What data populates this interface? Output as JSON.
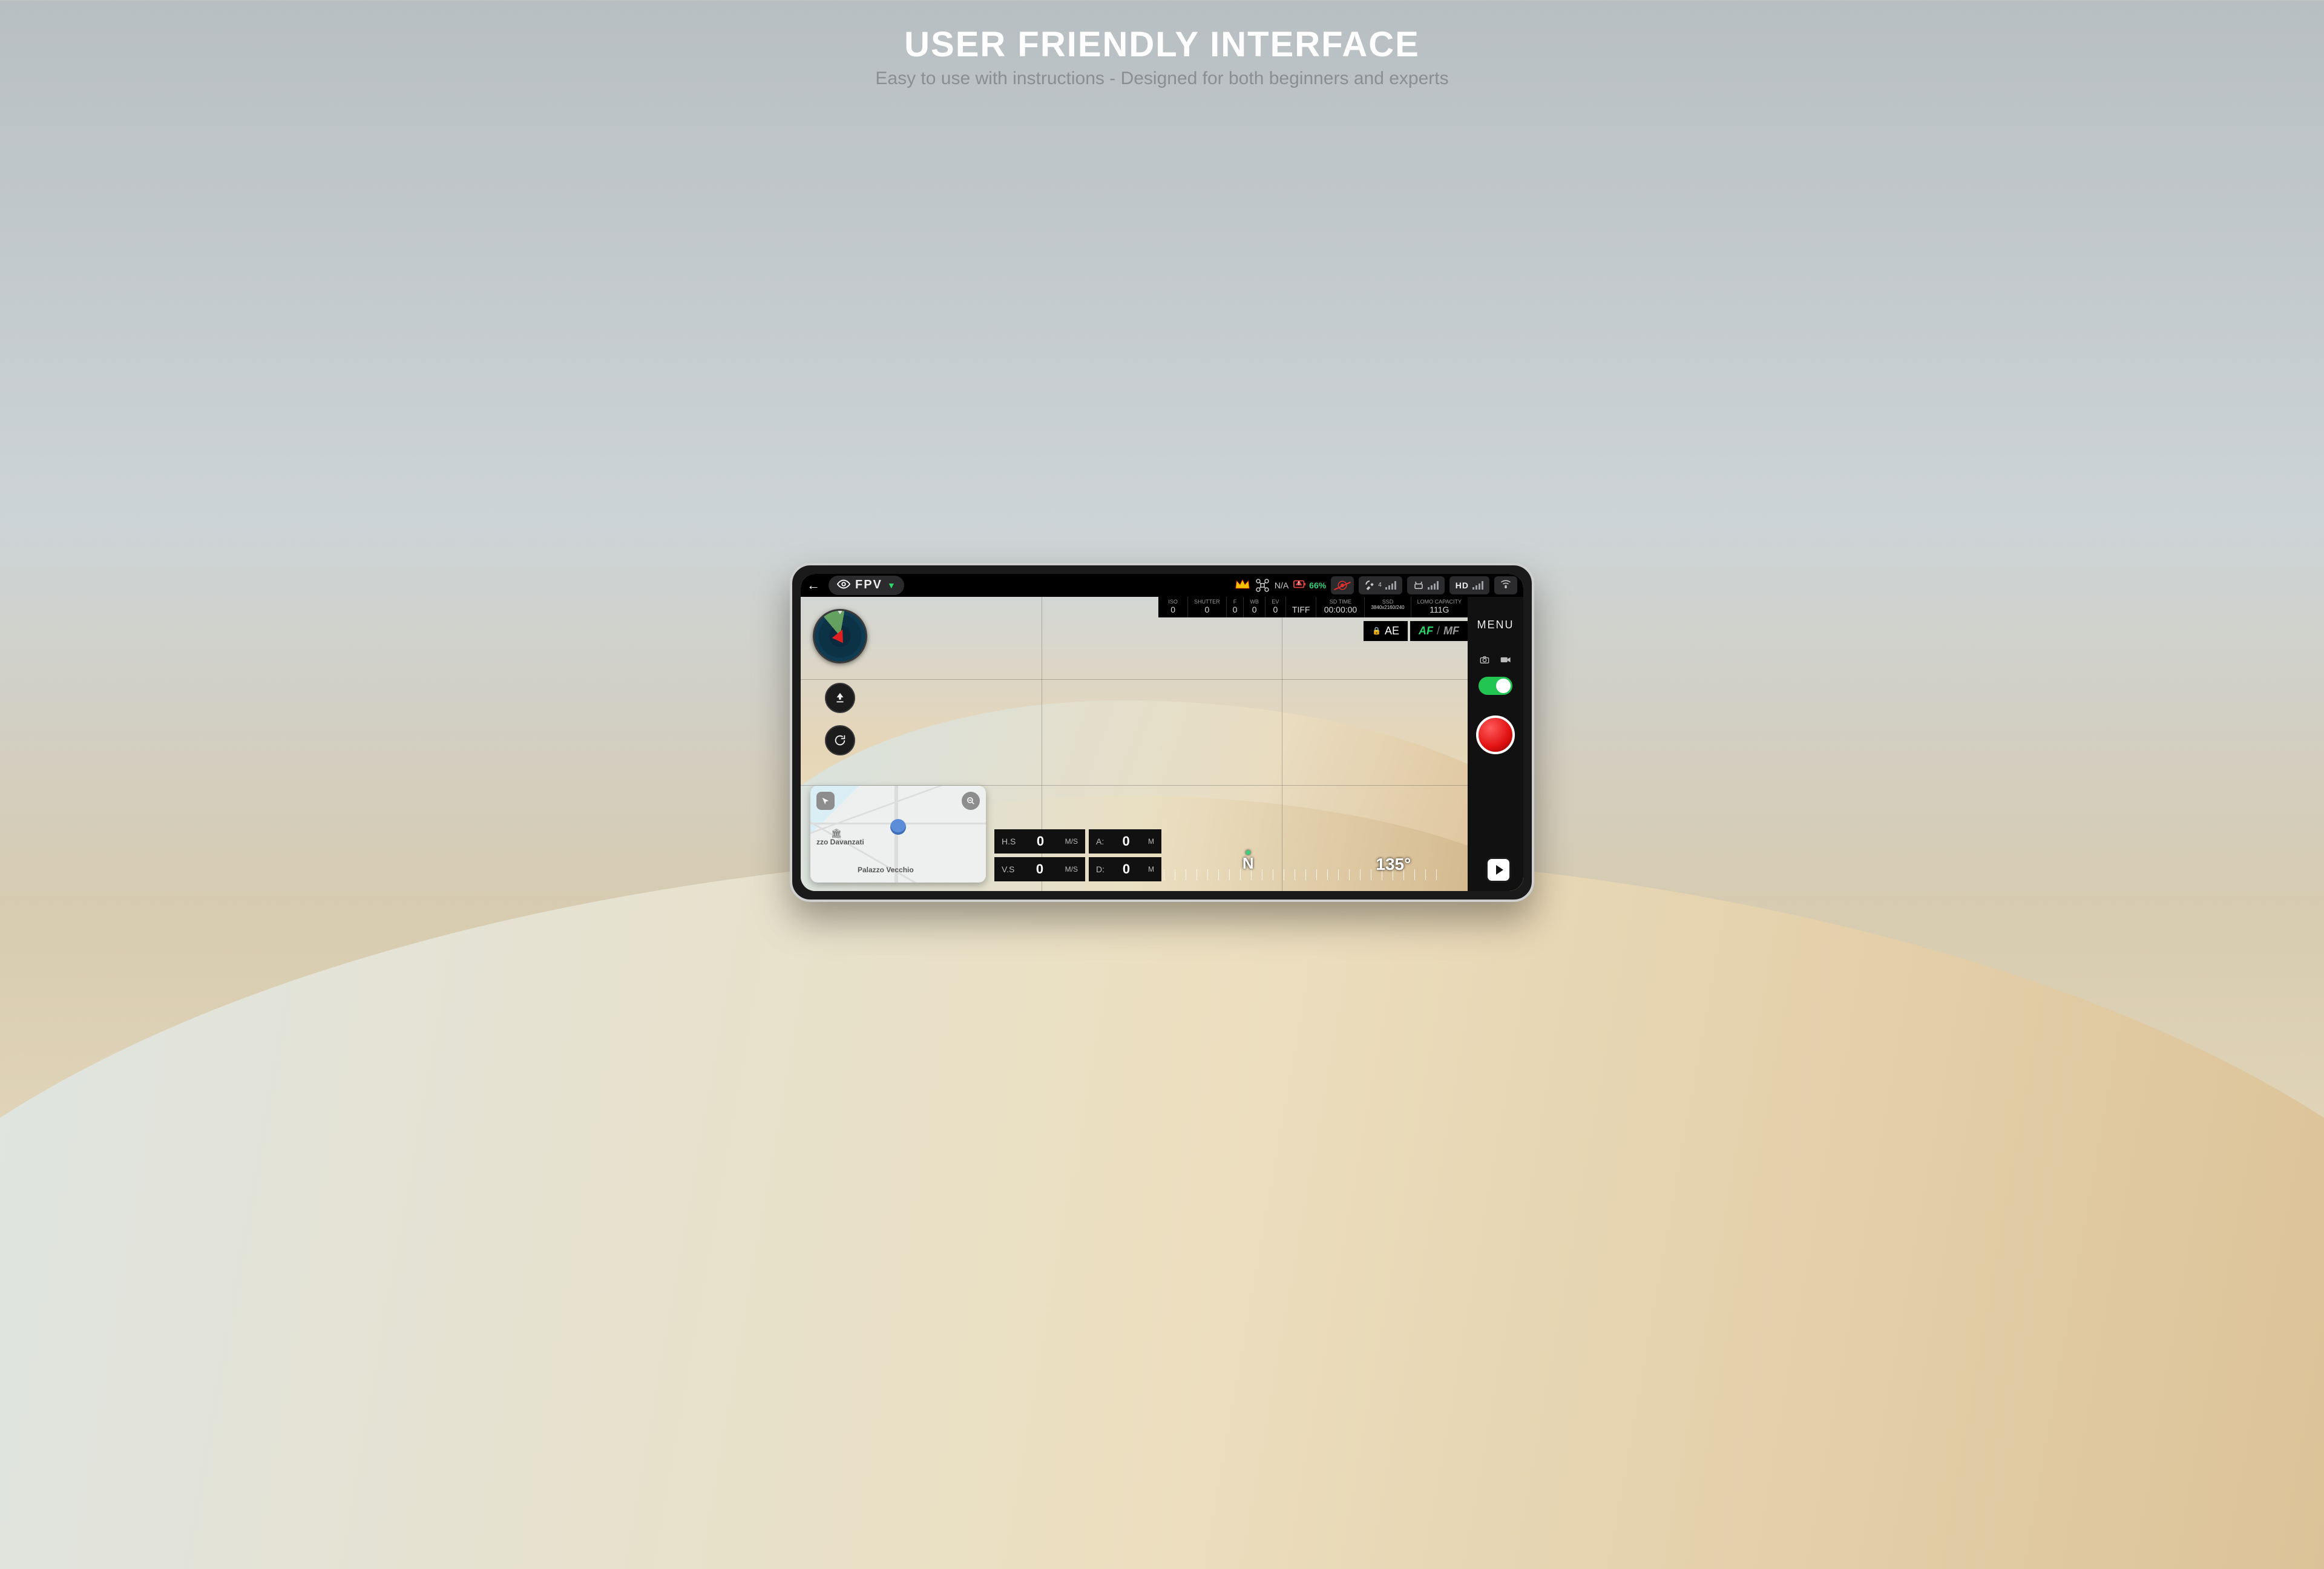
{
  "hero": {
    "title": "USER FRIENDLY INTERFACE",
    "subtitle": "Easy to use with instructions - Designed for both beginners and experts"
  },
  "topbar": {
    "mode": "FPV",
    "drone_status": "N/A",
    "battery_percent": "66%",
    "hd_label": "HD"
  },
  "camera": {
    "iso": {
      "label": "ISO",
      "value": "0"
    },
    "shutter": {
      "label": "SHUTTER",
      "value": "0"
    },
    "f": {
      "label": "F",
      "value": "0"
    },
    "wb": {
      "label": "WB",
      "value": "0"
    },
    "ev": {
      "label": "EV",
      "value": "0"
    },
    "format": {
      "label": "",
      "value": "TIFF"
    },
    "sdtime": {
      "label": "SD TIME",
      "value": "00:00:00"
    },
    "ssd": {
      "label": "SSD",
      "value": "3840x2160/240"
    },
    "capacity": {
      "label": "LOMO CAPACITY",
      "value": "111G"
    },
    "ae": "AE",
    "af": "AF",
    "mf": "MF",
    "menu": "MENU"
  },
  "telemetry": {
    "hs": {
      "label": "H.S",
      "value": "0",
      "unit": "M/S"
    },
    "a": {
      "label": "A:",
      "value": "0",
      "unit": "M"
    },
    "vs": {
      "label": "V.S",
      "value": "0",
      "unit": "M/S"
    },
    "d": {
      "label": "D:",
      "value": "0",
      "unit": "M"
    }
  },
  "compass": {
    "north": "N",
    "heading": "135°"
  },
  "map": {
    "label1": "zzo Davanzati",
    "label2": "Palazzo Vecchio"
  }
}
